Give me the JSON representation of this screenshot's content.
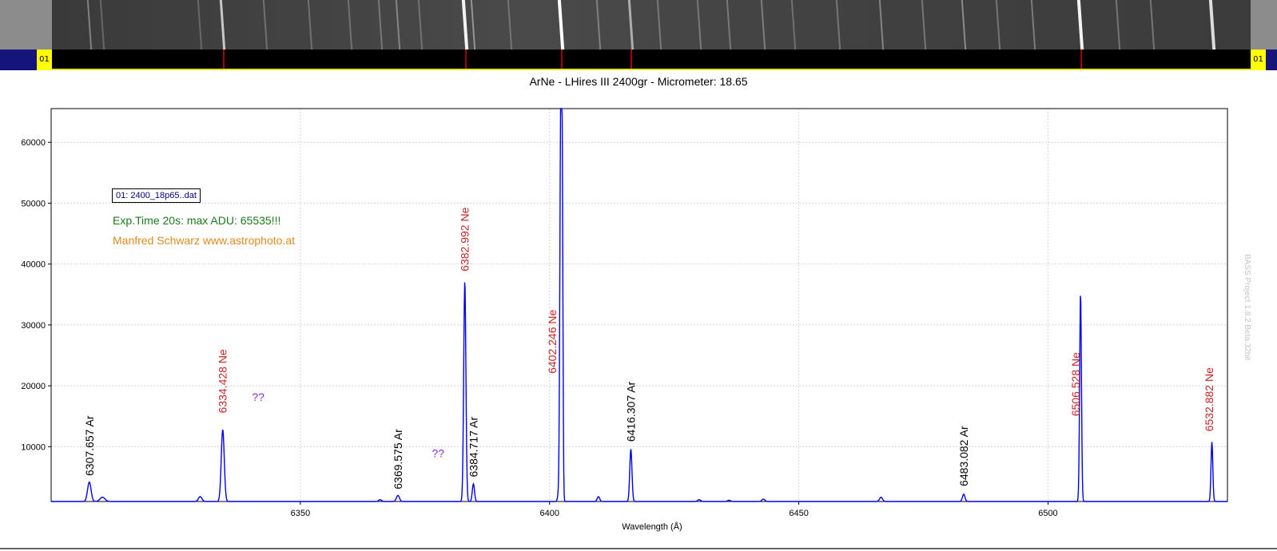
{
  "chart_data": {
    "type": "line",
    "title": "ArNe - LHires III 2400gr - Micrometer: 18.65",
    "xlabel": "Wavelength (Å)",
    "ylabel": "",
    "xlim": [
      6300,
      6536
    ],
    "ylim": [
      1000,
      65535
    ],
    "x_ticks": [
      6350,
      6400,
      6450,
      6500
    ],
    "y_ticks": [
      10000,
      20000,
      30000,
      40000,
      50000,
      60000
    ],
    "grid": true,
    "legend_placement": "top-left",
    "series": [
      {
        "name": "01: 2400_18p65..dat",
        "color": "#0000ee",
        "baseline": 1000,
        "peaks": [
          {
            "x": 6307.657,
            "y": 4200,
            "w": 0.35
          },
          {
            "x": 6310.3,
            "y": 1700,
            "w": 0.5
          },
          {
            "x": 6329.9,
            "y": 1800,
            "w": 0.35
          },
          {
            "x": 6334.428,
            "y": 12800,
            "w": 0.3
          },
          {
            "x": 6369.575,
            "y": 2000,
            "w": 0.3
          },
          {
            "x": 6366.0,
            "y": 1300,
            "w": 0.3
          },
          {
            "x": 6382.992,
            "y": 37200,
            "w": 0.22
          },
          {
            "x": 6384.717,
            "y": 3900,
            "w": 0.22
          },
          {
            "x": 6401.8,
            "y": 2100,
            "w": 0.2
          },
          {
            "x": 6402.246,
            "y": 65535,
            "w": 0.18
          },
          {
            "x": 6402.55,
            "y": 46000,
            "w": 0.14
          },
          {
            "x": 6409.8,
            "y": 1800,
            "w": 0.25
          },
          {
            "x": 6416.307,
            "y": 9600,
            "w": 0.22
          },
          {
            "x": 6430.0,
            "y": 1300,
            "w": 0.3
          },
          {
            "x": 6436.0,
            "y": 1200,
            "w": 0.3
          },
          {
            "x": 6442.9,
            "y": 1400,
            "w": 0.3
          },
          {
            "x": 6466.5,
            "y": 1700,
            "w": 0.3
          },
          {
            "x": 6483.082,
            "y": 2200,
            "w": 0.25
          },
          {
            "x": 6506.528,
            "y": 35200,
            "w": 0.18
          },
          {
            "x": 6532.882,
            "y": 10800,
            "w": 0.18
          }
        ]
      }
    ],
    "annotations": [
      {
        "text": "6307.657 Ar",
        "x": 6307.657,
        "y": 5200,
        "color": "#000000"
      },
      {
        "text": "6334.428 Ne",
        "x": 6334.428,
        "y": 15500,
        "color": "#cc2222"
      },
      {
        "text": "??",
        "x": 6340.3,
        "y": 17500,
        "color": "#8a2be2",
        "horizontal": true
      },
      {
        "text": "6369.575 Ar",
        "x": 6369.575,
        "y": 3000,
        "color": "#000000"
      },
      {
        "text": "??",
        "x": 6376.4,
        "y": 8300,
        "color": "#8a2be2",
        "horizontal": true
      },
      {
        "text": "6382.992 Ne",
        "x": 6382.992,
        "y": 38800,
        "color": "#cc2222"
      },
      {
        "text": "6384.717 Ar",
        "x": 6384.717,
        "y": 5000,
        "color": "#000000"
      },
      {
        "text": "6402.246 Ne",
        "x": 6400.5,
        "y": 22000,
        "color": "#cc2222"
      },
      {
        "text": "6416.307 Ar",
        "x": 6416.307,
        "y": 10800,
        "color": "#000000"
      },
      {
        "text": "6483.082 Ar",
        "x": 6483.082,
        "y": 3500,
        "color": "#000000"
      },
      {
        "text": "6506.528 Ne",
        "x": 6505.5,
        "y": 15000,
        "color": "#cc2222"
      },
      {
        "text": "6532.882 Ne",
        "x": 6532.3,
        "y": 12500,
        "color": "#cc2222"
      }
    ]
  },
  "legend_label": "01: 2400_18p65..dat",
  "exposure_note": "Exp.Time 20s: max ADU: 65535!!!",
  "credit_note": "Manfred Schwarz www.astrophoto.at",
  "watermark": "BASS Project 1.8.2 Beta 32bit",
  "track_label_left": "01",
  "track_label_right": "01",
  "colors": {
    "series": "#0000ee",
    "ne_label": "#cc2222",
    "ar_label": "#000000",
    "unknown_label": "#8a2be2",
    "exposure": "#1a7a1a",
    "credit": "#e08a1e",
    "track_marker": "#aa0000"
  },
  "strip_lines": [
    {
      "x": 6307.657,
      "intensity": 0.35
    },
    {
      "x": 6310.3,
      "intensity": 0.15
    },
    {
      "x": 6329.9,
      "intensity": 0.15
    },
    {
      "x": 6334.428,
      "intensity": 0.75
    },
    {
      "x": 6343.0,
      "intensity": 0.2
    },
    {
      "x": 6352.0,
      "intensity": 0.2
    },
    {
      "x": 6360.0,
      "intensity": 0.2
    },
    {
      "x": 6366.0,
      "intensity": 0.25
    },
    {
      "x": 6369.575,
      "intensity": 0.35
    },
    {
      "x": 6374.0,
      "intensity": 0.2
    },
    {
      "x": 6382.992,
      "intensity": 0.95
    },
    {
      "x": 6384.717,
      "intensity": 0.45
    },
    {
      "x": 6392.0,
      "intensity": 0.2
    },
    {
      "x": 6402.246,
      "intensity": 1.0
    },
    {
      "x": 6409.8,
      "intensity": 0.3
    },
    {
      "x": 6416.307,
      "intensity": 0.6
    },
    {
      "x": 6422.0,
      "intensity": 0.25
    },
    {
      "x": 6430.0,
      "intensity": 0.25
    },
    {
      "x": 6436.0,
      "intensity": 0.25
    },
    {
      "x": 6442.9,
      "intensity": 0.3
    },
    {
      "x": 6449.0,
      "intensity": 0.2
    },
    {
      "x": 6458.0,
      "intensity": 0.25
    },
    {
      "x": 6466.5,
      "intensity": 0.35
    },
    {
      "x": 6475.0,
      "intensity": 0.25
    },
    {
      "x": 6483.082,
      "intensity": 0.4
    },
    {
      "x": 6490.0,
      "intensity": 0.25
    },
    {
      "x": 6497.0,
      "intensity": 0.3
    },
    {
      "x": 6506.528,
      "intensity": 0.95
    },
    {
      "x": 6514.0,
      "intensity": 0.25
    },
    {
      "x": 6521.0,
      "intensity": 0.25
    },
    {
      "x": 6532.882,
      "intensity": 0.85
    }
  ],
  "track_markers": [
    6334.428,
    6382.992,
    6402.246,
    6416.307,
    6506.528
  ]
}
